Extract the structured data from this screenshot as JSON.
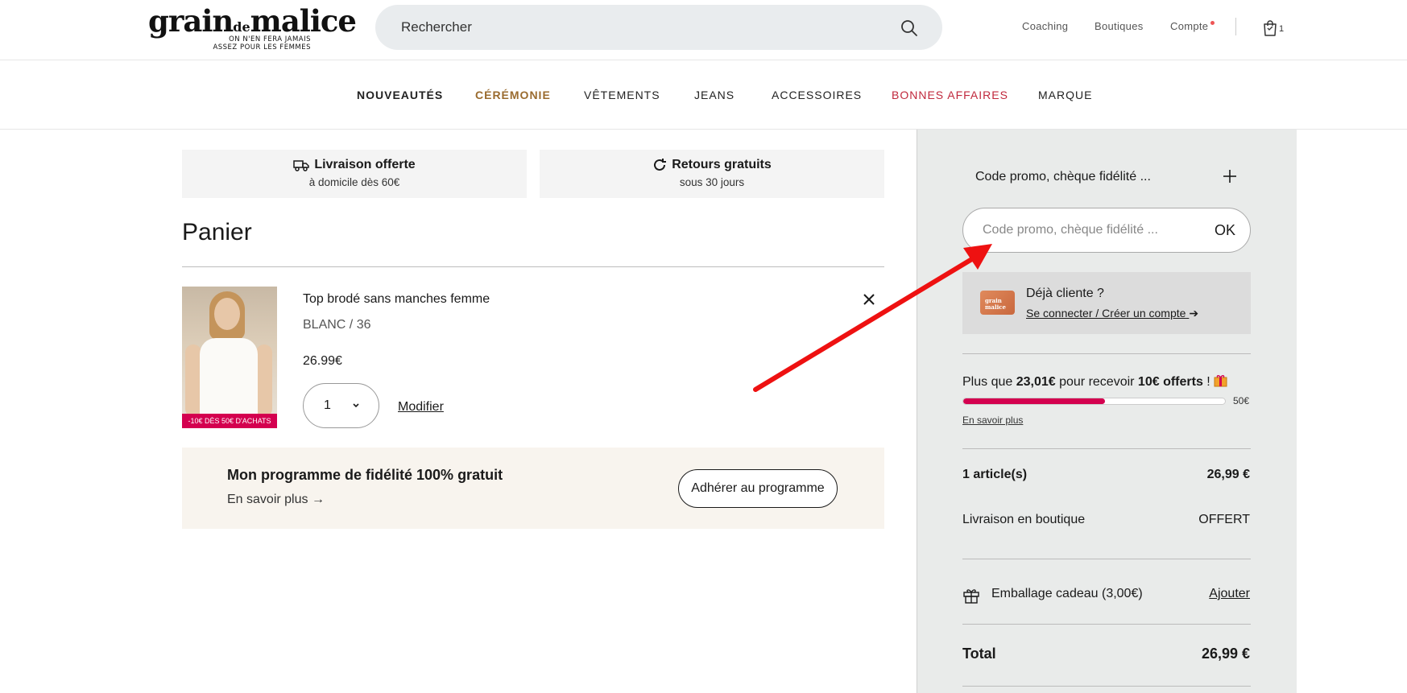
{
  "header": {
    "logo_main_1": "grain",
    "logo_main_de": "de",
    "logo_main_2": "malice",
    "logo_tag_1": "ON N'EN FERA JAMAIS",
    "logo_tag_2": "ASSEZ POUR LES FEMMES",
    "search_placeholder": "Rechercher",
    "links": {
      "coaching": "Coaching",
      "boutiques": "Boutiques",
      "compte": "Compte"
    },
    "cart_count": "1"
  },
  "mainnav": {
    "items": [
      "NOUVEAUTÉS",
      "CÉRÉMONIE",
      "VÊTEMENTS",
      "JEANS",
      "ACCESSOIRES",
      "BONNES AFFAIRES",
      "MARQUE"
    ]
  },
  "perks": {
    "delivery_title": "Livraison offerte",
    "delivery_sub": "à domicile dès 60€",
    "returns_title": "Retours gratuits",
    "returns_sub": "sous 30 jours"
  },
  "cart": {
    "title": "Panier",
    "item": {
      "name": "Top brodé sans manches femme",
      "variant": "BLANC / 36",
      "price": "26.99€",
      "quantity": "1",
      "modify_label": "Modifier",
      "ribbon": "-10€ DÈS 50€ D'ACHATS"
    },
    "loyalty": {
      "title": "Mon programme de fidélité 100% gratuit",
      "link": "En savoir plus →",
      "button": "Adhérer au programme"
    }
  },
  "sidebar": {
    "promo_heading": "Code promo, chèque fidélité ...",
    "promo_placeholder": "Code promo, chèque fidélité ...",
    "promo_ok": "OK",
    "card_text": "grain malice",
    "deja_question": "Déjà cliente ?",
    "deja_link": "Se connecter / Créer un compte",
    "progress": {
      "prefix": "Plus que ",
      "amount": "23,01€",
      "middle": " pour recevoir ",
      "reward": "10€ offerts",
      "suffix": " !",
      "max_label": "50€",
      "fraction": 0.54,
      "more": "En savoir plus"
    },
    "summary": {
      "articles_label": "1 article(s)",
      "articles_value": "26,99 €",
      "shipping_label": "Livraison en boutique",
      "shipping_value": "OFFERT",
      "gift_label": "Emballage cadeau (3,00€)",
      "gift_action": "Ajouter",
      "total_label": "Total",
      "total_value": "26,99 €"
    }
  },
  "colors": {
    "ceremonie": "#9a6b2f",
    "bonnes_affaires": "#c0283c",
    "accent_pink": "#d4004f",
    "annotation_arrow": "#ee1111"
  }
}
